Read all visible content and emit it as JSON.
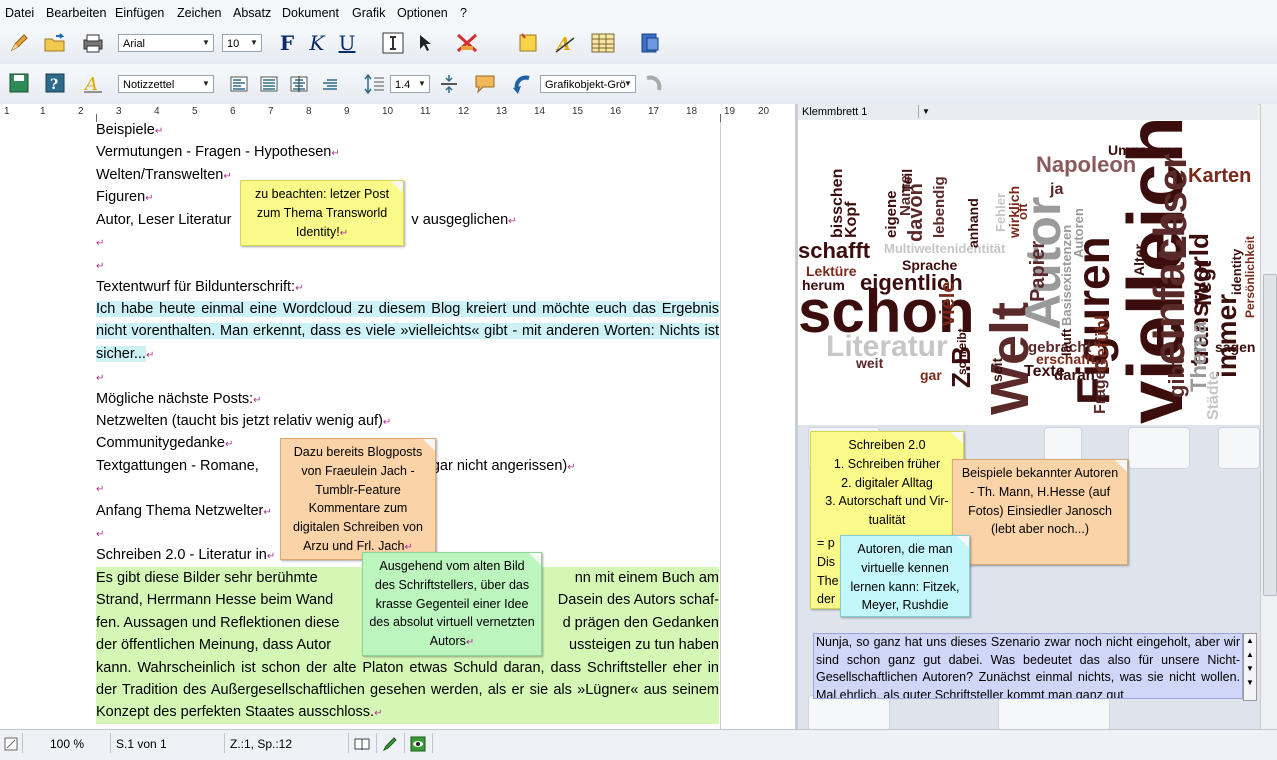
{
  "menu": [
    "Datei",
    "Bearbeiten",
    "Einfügen",
    "Zeichen",
    "Absatz",
    "Dokument",
    "Grafik",
    "Optionen",
    "?"
  ],
  "toolbar": {
    "font_name": "Arial",
    "font_size": "10",
    "bold_label": "F",
    "italic_label": "K",
    "underline_label": "U",
    "style": "Notizzettel",
    "line_spacing": "1.4",
    "graphic_object": "Grafikobjekt-Grö"
  },
  "ruler_numbers": [
    "1",
    "1",
    "2",
    "3",
    "4",
    "5",
    "6",
    "7",
    "8",
    "9",
    "10",
    "11",
    "12",
    "13",
    "14",
    "15",
    "16",
    "17",
    "18",
    "19",
    "20"
  ],
  "doc": {
    "lines": [
      "Beispiele",
      "Vermutungen - Fragen - Hypothesen",
      "Welten/Transwelten",
      "Figuren",
      "Autor, Leser Literatur",
      "v ausgeglichen",
      "Textentwurf für Bildunterschrift:",
      "Ich habe heute einmal eine Wordcloud zu diesem Blog kreiert und möchte euch das Ergebnis nicht vorenthalten. Man erkennt, dass es viele »vielleichts« gibt - mit anderen Worten: Nichts ist sicher...",
      "Mögliche nächste Posts:",
      "Netzwelten (taucht bis jetzt relativ wenig auf)",
      "Communitygedanke",
      "Textgattungen - Romane,",
      "gar nicht angerissen)",
      "Anfang Thema Netzwelter",
      "Schreiben 2.0 - Literatur in",
      "Es gibt diese Bilder sehr berühmte",
      "nn mit einem Buch am",
      "Strand, Herrmann Hesse beim Wand",
      "Dasein des Autors schaf-",
      "fen. Aussagen und Reflektionen diese",
      "d prägen den Gedanken",
      "der öffentlichen Meinung, dass Autor",
      "ussteigen zu tun haben",
      "kann. Wahrscheinlich ist schon der alte Platon etwas Schuld daran, dass Schriftsteller eher in der Tradition des Außergesellschaftlichen gesehen werden, als er sie als »Lügner« aus seinem Konzept des perfekten Staates ausschloss."
    ]
  },
  "notes": {
    "note1": "zu beachten: letzer Post zum Thema Transworld Identity!",
    "note2": "Dazu bereits Blogposts von Fraeulein Jach - Tumblr-Feature Kommentare zum digitalen Schreiben von Arzu und Frl. Jach",
    "note3": "Ausgehend vom alten Bild des Schriftstellers, über das krasse Gegenteil einer Idee des absolut virtuell vernetzten Autors"
  },
  "clipboard": {
    "title": "Klemmbrett 1",
    "note_schreiben": [
      "Schreiben 2.0",
      "1. Schreiben früher",
      "2. digitaler Alltag",
      "3. Autorschaft und Vir-",
      "tualität"
    ],
    "note_schreiben_tail": [
      "= p",
      "Dis",
      "The",
      "der"
    ],
    "note_beispiele": "Beispiele bekannter Autoren - Th. Mann, H.Hesse (auf Fotos) Einsiedler Janosch (lebt aber noch...)",
    "note_autoren": "Autoren, die man virtuelle kennen lernen kann: Fitzek, Meyer, Rushdie",
    "text": "Nunja, so ganz hat uns dieses Szenario zwar noch nicht eingeholt, aber wir sind schon ganz gut dabei. Was bedeutet das also für unsere Nicht-Gesellschaftlichen Autoren? Zunächst einmal nichts, was sie nicht wollen. Mal ehrlich, als guter Schriftsteller kommt man ganz gut"
  },
  "cloud_words": [
    "vielleicht",
    "schon",
    "Welt",
    "Figuren",
    "einfach",
    "Autor",
    "Leser",
    "Literatur",
    "eigentlich",
    "Napoleon",
    "Karten",
    "immer",
    "transworld",
    "Papier",
    "schafft",
    "viele",
    "Z.B",
    "davon",
    "Umgebung",
    "liegt",
    "gibt",
    "Gefühl",
    "Texte",
    "daran",
    "gebracht",
    "erschafft",
    "Sprache",
    "Thema",
    "Lektüre",
    "herum",
    "weit",
    "sagen",
    "Multiweltenidentität",
    "ja",
    "wirklich",
    "Fragen",
    "bisschen",
    "Kopf",
    "eigene",
    "Name",
    "Teil",
    "lebendig",
    "anhand",
    "seit",
    "gar",
    "Alter",
    "läuft",
    "schreibt",
    "Basisexistenzen",
    "Städte",
    "identity",
    "Autoren",
    "oft",
    "Fehler",
    "Persönlichkeit"
  ],
  "status": {
    "zoom": "100 %",
    "page": "S.1 von 1",
    "position": "Z.:1, Sp.:12"
  },
  "colors": {
    "highlight_cyan": "#cdf2f6",
    "highlight_green": "#d4f7b6",
    "note_yellow": "#fafa8a",
    "note_orange": "#fbd3a8",
    "note_green": "#bdf5bf",
    "note_cyan": "#c3f7fb",
    "cloud_dark": "#3b0d0d",
    "cloud_brown": "#7a2a1a",
    "cloud_gray": "#9a9a9a"
  }
}
